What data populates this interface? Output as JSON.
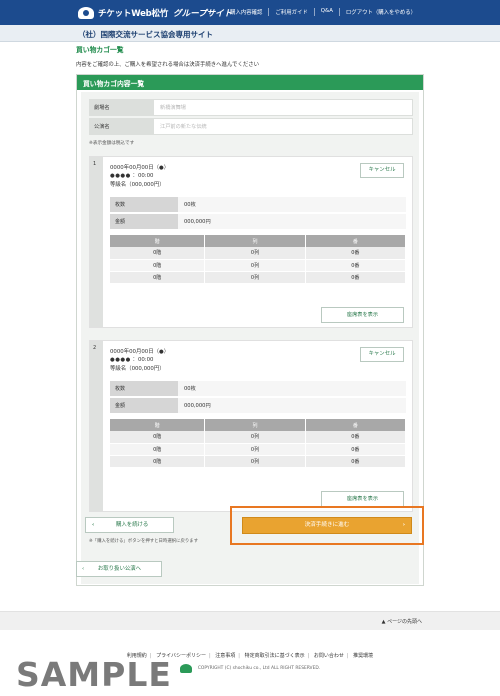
{
  "header": {
    "logo_text": "チケットWeb松竹",
    "logo_sub": "グループサイト",
    "nav": [
      "購入内容確認",
      "ご利用ガイド",
      "Q&A",
      "ログアウト（購入をやめる）"
    ]
  },
  "org_title": "（社）国際交流サービス協会専用サイト",
  "page_title": "買い物カゴ一覧",
  "intro": "内容をご確認の上、ご購入を希望される場合は決済手続きへ進んでください",
  "panel_title": "買い物カゴ内容一覧",
  "info": {
    "rows": [
      {
        "label": "劇場名",
        "value": "新橋演舞場"
      },
      {
        "label": "公演名",
        "value": "江戸前の新たな伝統"
      }
    ],
    "tax_note": "※表示金額は税込です"
  },
  "tickets": [
    {
      "num": "1",
      "date": "0000年00月00日（●）",
      "time_dots": "●●●●",
      "time": "：00:00",
      "grade": "等級名（000,000円）",
      "cancel_label": "キャンセル",
      "qty_label": "枚数",
      "qty_value": "00枚",
      "amount_label": "金額",
      "amount_value": "000,000円",
      "seat_headers": [
        "階",
        "列",
        "番"
      ],
      "seats": [
        [
          "0階",
          "0列",
          "0番"
        ],
        [
          "0階",
          "0列",
          "0番"
        ],
        [
          "0階",
          "0列",
          "0番"
        ]
      ],
      "seatmap_label": "座席表を表示"
    },
    {
      "num": "2",
      "date": "0000年00月00日（●）",
      "time_dots": "●●●●",
      "time": "：00:00",
      "grade": "等級名（000,000円）",
      "cancel_label": "キャンセル",
      "qty_label": "枚数",
      "qty_value": "00枚",
      "amount_label": "金額",
      "amount_value": "000,000円",
      "seat_headers": [
        "階",
        "列",
        "番"
      ],
      "seats": [
        [
          "0階",
          "0列",
          "0番"
        ],
        [
          "0階",
          "0列",
          "0番"
        ],
        [
          "0階",
          "0列",
          "0番"
        ]
      ],
      "seatmap_label": "座席表を表示"
    }
  ],
  "actions": {
    "continue_label": "購入を続ける",
    "continue_note": "※「購入を続ける」ボタンを押すと日時選択に戻ります",
    "checkout_label": "決済手続きに進む",
    "back_label": "お取り扱い公演へ"
  },
  "footer": {
    "pagetop": "▲ ページの先頭へ",
    "links": [
      "利用規約",
      "プライバシーポリシー",
      "注意事項",
      "特定商取引法に基づく表示",
      "お問い合わせ",
      "推奨環境"
    ],
    "copyright": "COPYRIGHT (C) shochiku co., Ltd ALL RIGHT RESERVED."
  },
  "watermark": "SAMPLE",
  "colors": {
    "header": "#1c4b8e",
    "accent_green": "#2b9a58",
    "checkout": "#e9a330",
    "highlight": "#e87722"
  }
}
